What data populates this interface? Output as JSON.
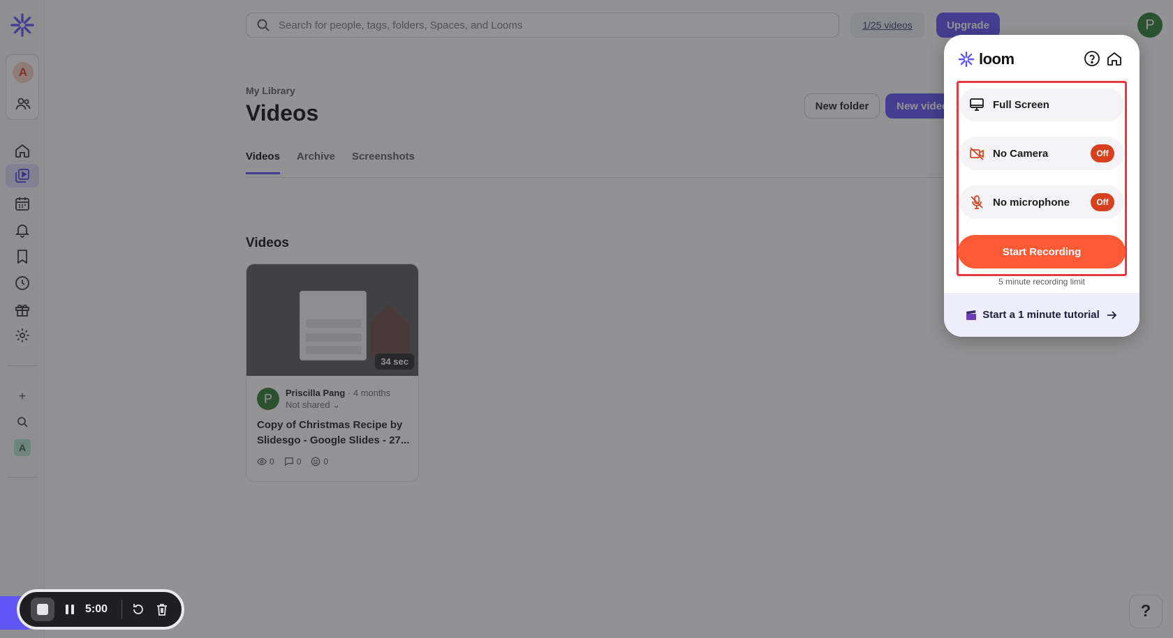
{
  "search": {
    "placeholder": "Search for people, tags, folders, Spaces, and Looms"
  },
  "header": {
    "videos_count": "1/25 videos",
    "upgrade_label": "Upgrade",
    "user_initial": "P"
  },
  "sidebar": {
    "workspace_initial": "A",
    "add_label": "+",
    "space_initial": "A"
  },
  "library": {
    "breadcrumb": "My Library",
    "title": "Videos",
    "new_folder_label": "New folder",
    "new_video_label": "New video",
    "tabs": [
      {
        "label": "Videos"
      },
      {
        "label": "Archive"
      },
      {
        "label": "Screenshots"
      }
    ],
    "section_title": "Videos"
  },
  "video_card": {
    "duration": "34 sec",
    "author_initial": "P",
    "author": "Priscilla Pang",
    "ago": " · 4 months",
    "shared_status": "Not shared",
    "title": "Copy of Christmas Recipe by Slidesgo - Google Slides - 27...",
    "views": "0",
    "comments": "0",
    "reactions": "0"
  },
  "help_fab": "?",
  "recorder": {
    "time": "5:00"
  },
  "popup": {
    "brand": "loom",
    "options": [
      {
        "label": "Full Screen"
      },
      {
        "label": "No Camera",
        "state": "Off"
      },
      {
        "label": "No microphone",
        "state": "Off"
      }
    ],
    "start_label": "Start Recording",
    "limit_text": "5 minute recording limit",
    "tutorial_label": "Start a 1 minute tutorial"
  },
  "colors": {
    "accent": "#6155f5",
    "record": "#ff5a36",
    "toggle_off": "#d7401f",
    "highlight": "#e5393d"
  }
}
